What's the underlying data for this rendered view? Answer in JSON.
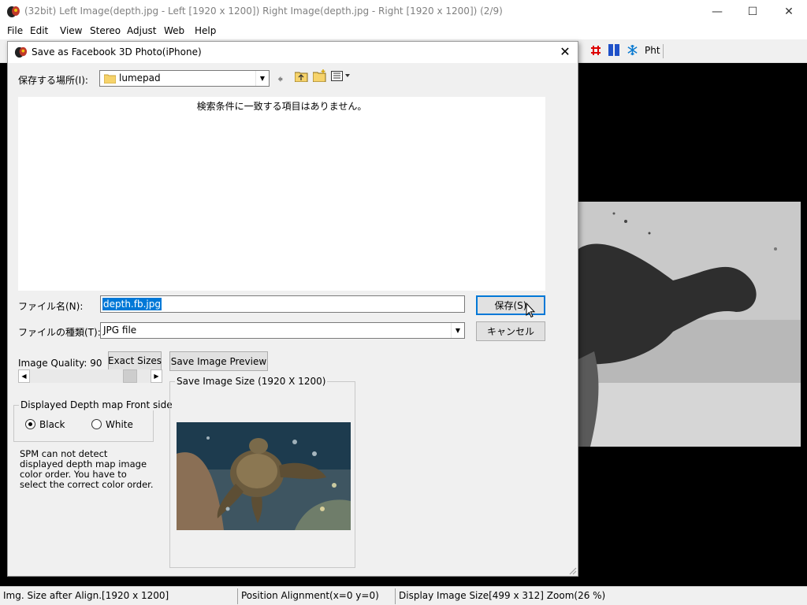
{
  "app": {
    "title": "(32bit) Left Image(depth.jpg - Left [1920 x 1200]) Right Image(depth.jpg - Right [1920 x 1200])  (2/9)",
    "icons": [
      "app-icon",
      "minimize-icon",
      "maximize-icon",
      "close-icon"
    ]
  },
  "menu": [
    "File",
    "Edit",
    "View",
    "Stereo",
    "Adjust",
    "Web",
    "Help"
  ],
  "toolbar": {
    "pht_label": "Pht",
    "icons": [
      "hash-icon",
      "flag-icon",
      "snowflake-icon"
    ]
  },
  "dialog": {
    "title": "Save as Facebook 3D Photo(iPhone)",
    "save_in_label": "保存する場所(I):",
    "save_in_value": "lumepad",
    "empty_message": "検索条件に一致する項目はありません。",
    "filename_label": "ファイル名(N):",
    "filename_value": "depth.fb.jpg",
    "filetype_label": "ファイルの種類(T):",
    "filetype_value": "JPG file",
    "save_button": "保存(S)",
    "cancel_button": "キャンセル",
    "quality_label": "Image Quality:",
    "quality_value": "90",
    "exact_sizes_button": "Exact Sizes",
    "save_preview_button": "Save Image Preview",
    "depth_group_title": "Displayed Depth map Front side",
    "radio_black": "Black",
    "radio_white": "White",
    "selected_depth_side": "Black",
    "note": "SPM can not detect displayed depth map image color order. You have to select the correct color order.",
    "preview_group_title": "Save Image Size (1920 X 1200)"
  },
  "status": {
    "size_after_align": "Img. Size after Align.[1920 x 1200]",
    "position_alignment": "Position Alignment(x=0 y=0)",
    "display_size": "Display Image Size[499 x 312]  Zoom(26 %)"
  },
  "colors": {
    "selection": "#0078d7",
    "dialog_bg": "#f0f0f0",
    "canvas_bg": "#000000"
  }
}
